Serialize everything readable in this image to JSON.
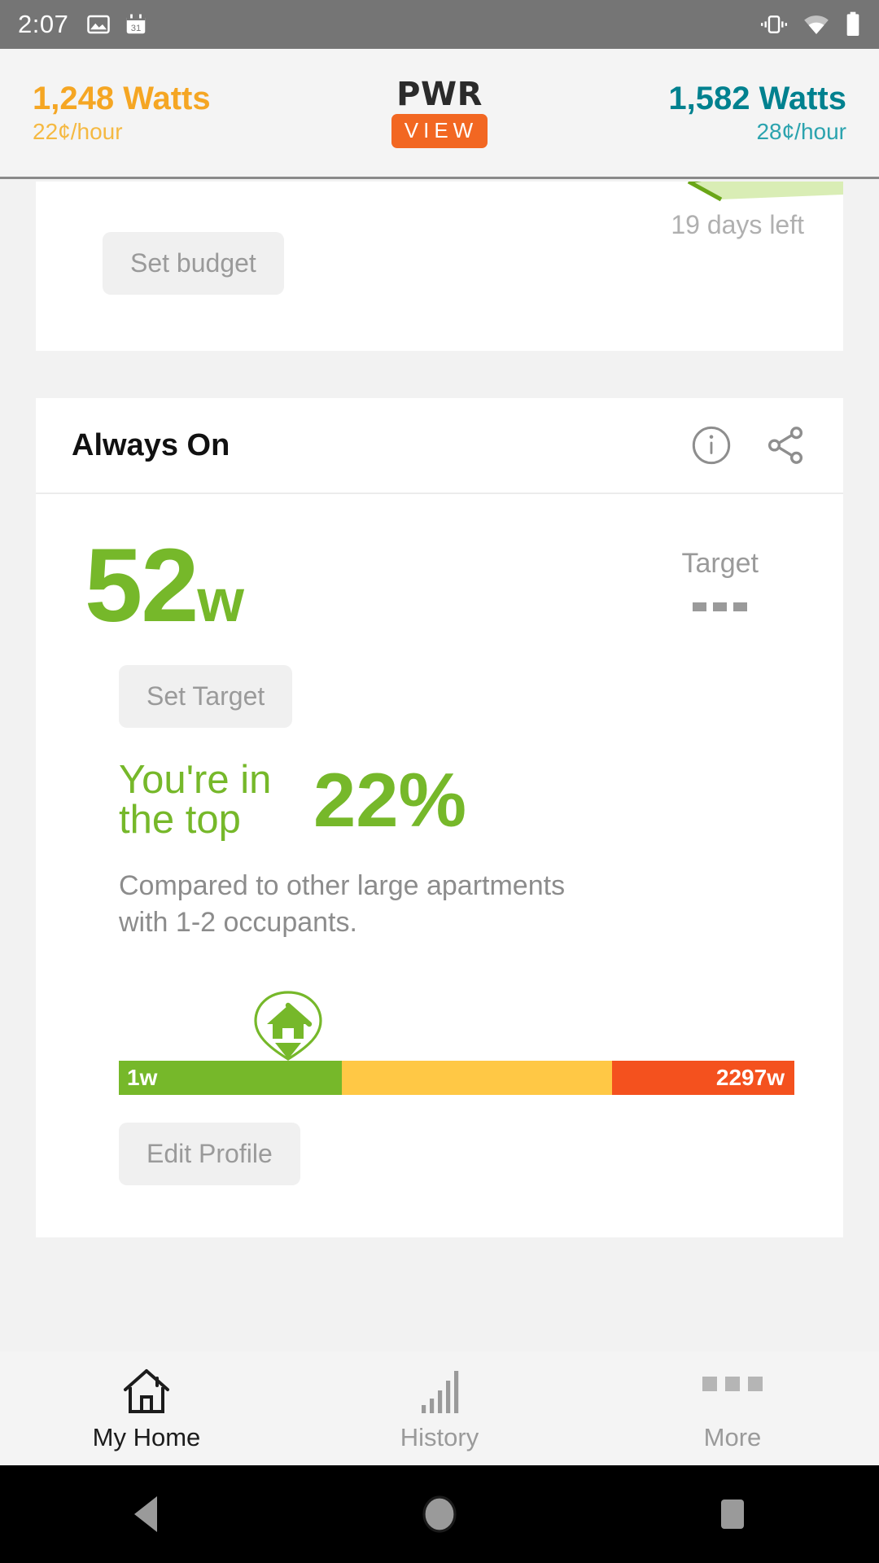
{
  "status_bar": {
    "time": "2:07",
    "left_icons": [
      "image-icon",
      "calendar-icon"
    ],
    "calendar_day": "31",
    "right_icons": [
      "vibrate-icon",
      "wifi-icon",
      "battery-icon"
    ]
  },
  "app_header": {
    "left": {
      "watts": "1,248 Watts",
      "rate": "22¢/hour",
      "color": "#f5a623"
    },
    "right": {
      "watts": "1,582 Watts",
      "rate": "28¢/hour",
      "color": "#00818f"
    },
    "logo": {
      "top": "PWR",
      "bottom": "VIEW",
      "accent": "#f26722"
    }
  },
  "budget_card": {
    "days_left": "19 days left",
    "set_budget_label": "Set budget"
  },
  "always_on_card": {
    "title": "Always On",
    "info_icon": "info-icon",
    "share_icon": "share-icon",
    "value_number": "52",
    "value_unit": "w",
    "value_color": "#76b82a",
    "target_label": "Target",
    "target_value": "---",
    "set_target_label": "Set Target",
    "rank_prefix": "You're in the top",
    "rank_percent": "22%",
    "comparison": "Compared to other large apartments with 1-2 occupants.",
    "edit_profile_label": "Edit Profile",
    "range": {
      "min_label": "1w",
      "max_label": "2297w",
      "marker_icon": "home-pin-icon",
      "marker_position_pct": 25,
      "segments": [
        {
          "name": "low",
          "color": "#76b82a",
          "width_pct": 33
        },
        {
          "name": "medium",
          "color": "#ffc845",
          "width_pct": 40
        },
        {
          "name": "high",
          "color": "#f4511e",
          "width_pct": 27
        }
      ]
    }
  },
  "bottom_nav": {
    "items": [
      {
        "label": "My Home",
        "icon": "home-icon",
        "active": true
      },
      {
        "label": "History",
        "icon": "bar-chart-icon",
        "active": false
      },
      {
        "label": "More",
        "icon": "more-dots-icon",
        "active": false
      }
    ]
  },
  "android_nav": {
    "back": "back-triangle-icon",
    "home": "home-circle-icon",
    "recents": "recents-square-icon"
  }
}
